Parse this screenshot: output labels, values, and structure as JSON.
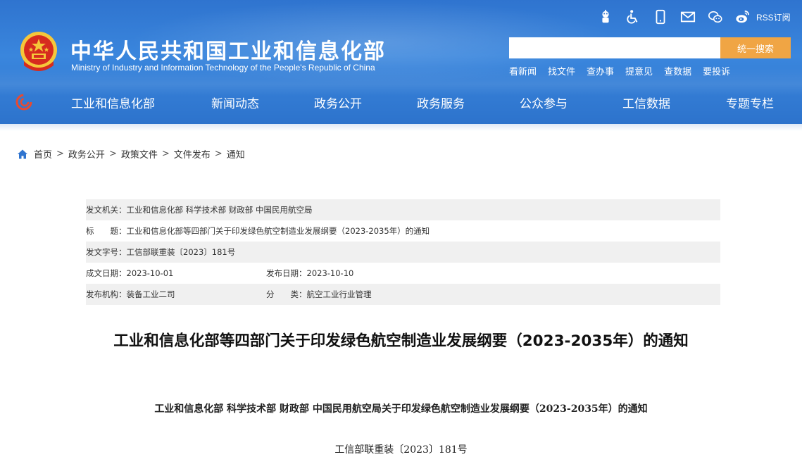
{
  "header": {
    "title": "中华人民共和国工业和信息化部",
    "subtitle": "Ministry of Industry and Information Technology of the People's Republic of China",
    "tools": [
      {
        "icon": "robot-assistant-icon"
      },
      {
        "icon": "accessibility-icon"
      },
      {
        "icon": "mobile-phone-icon"
      },
      {
        "icon": "mail-icon"
      },
      {
        "icon": "wechat-icon"
      },
      {
        "icon": "weibo-icon"
      }
    ],
    "rss_label": "RSS订阅",
    "search": {
      "placeholder": "",
      "button_label": "统一搜索"
    },
    "quick_links": [
      "看新闻",
      "找文件",
      "查办事",
      "提意见",
      "查数据",
      "要投诉"
    ],
    "nav": [
      "工业和信息化部",
      "新闻动态",
      "政务公开",
      "政务服务",
      "公众参与",
      "工信数据",
      "专题专栏"
    ]
  },
  "breadcrumb": [
    "首页",
    "政务公开",
    "政策文件",
    "文件发布",
    "通知"
  ],
  "info": {
    "issuer": {
      "label": "发文机关：",
      "value": "工业和信息化部 科学技术部 财政部 中国民用航空局"
    },
    "title": {
      "label": "标　　题：",
      "value": "工业和信息化部等四部门关于印发绿色航空制造业发展纲要（2023-2035年）的通知"
    },
    "doc_no": {
      "label": "发文字号：",
      "value": "工信部联重装〔2023〕181号"
    },
    "created": {
      "label": "成文日期：",
      "value": "2023-10-01"
    },
    "published": {
      "label": "发布日期：",
      "value": "2023-10-10"
    },
    "agency": {
      "label": "发布机构：",
      "value": "装备工业二司"
    },
    "category": {
      "label": "分　　类：",
      "value": "航空工业行业管理"
    }
  },
  "article": {
    "title": "工业和信息化部等四部门关于印发绿色航空制造业发展纲要（2023-2035年）的通知",
    "subtitle": "工业和信息化部 科学技术部 财政部 中国民用航空局关于印发绿色航空制造业发展纲要（2023-2035年）的通知",
    "doc_no": "工信部联重装〔2023〕181号"
  },
  "colors": {
    "header_blue": "#3a86dd",
    "search_button": "#f0a544",
    "row_shade": "#f0f0f0"
  }
}
